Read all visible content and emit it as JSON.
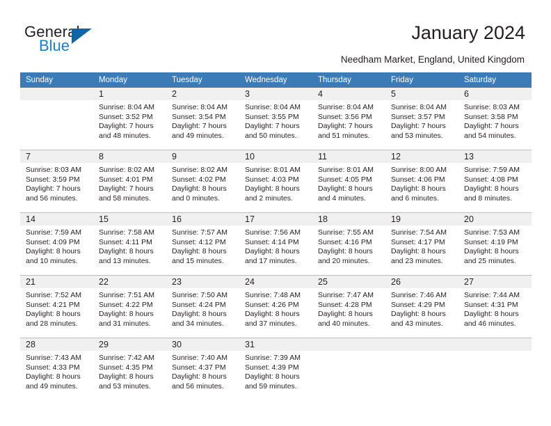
{
  "logo": {
    "word1": "General",
    "word2": "Blue",
    "triangle_color": "#1164a6",
    "blue_color": "#1f7dc0"
  },
  "header": {
    "title": "January 2024",
    "subtitle": "Needham Market, England, United Kingdom",
    "header_bg": "#3b7cb8",
    "daynum_bg": "#f0f0f0"
  },
  "weekdays": [
    "Sunday",
    "Monday",
    "Tuesday",
    "Wednesday",
    "Thursday",
    "Friday",
    "Saturday"
  ],
  "weeks": [
    [
      {
        "day": "",
        "sunrise": "",
        "sunset": "",
        "daylight_line1": "",
        "daylight_line2": ""
      },
      {
        "day": "1",
        "sunrise": "Sunrise: 8:04 AM",
        "sunset": "Sunset: 3:52 PM",
        "daylight_line1": "Daylight: 7 hours",
        "daylight_line2": "and 48 minutes."
      },
      {
        "day": "2",
        "sunrise": "Sunrise: 8:04 AM",
        "sunset": "Sunset: 3:54 PM",
        "daylight_line1": "Daylight: 7 hours",
        "daylight_line2": "and 49 minutes."
      },
      {
        "day": "3",
        "sunrise": "Sunrise: 8:04 AM",
        "sunset": "Sunset: 3:55 PM",
        "daylight_line1": "Daylight: 7 hours",
        "daylight_line2": "and 50 minutes."
      },
      {
        "day": "4",
        "sunrise": "Sunrise: 8:04 AM",
        "sunset": "Sunset: 3:56 PM",
        "daylight_line1": "Daylight: 7 hours",
        "daylight_line2": "and 51 minutes."
      },
      {
        "day": "5",
        "sunrise": "Sunrise: 8:04 AM",
        "sunset": "Sunset: 3:57 PM",
        "daylight_line1": "Daylight: 7 hours",
        "daylight_line2": "and 53 minutes."
      },
      {
        "day": "6",
        "sunrise": "Sunrise: 8:03 AM",
        "sunset": "Sunset: 3:58 PM",
        "daylight_line1": "Daylight: 7 hours",
        "daylight_line2": "and 54 minutes."
      }
    ],
    [
      {
        "day": "7",
        "sunrise": "Sunrise: 8:03 AM",
        "sunset": "Sunset: 3:59 PM",
        "daylight_line1": "Daylight: 7 hours",
        "daylight_line2": "and 56 minutes."
      },
      {
        "day": "8",
        "sunrise": "Sunrise: 8:02 AM",
        "sunset": "Sunset: 4:01 PM",
        "daylight_line1": "Daylight: 7 hours",
        "daylight_line2": "and 58 minutes."
      },
      {
        "day": "9",
        "sunrise": "Sunrise: 8:02 AM",
        "sunset": "Sunset: 4:02 PM",
        "daylight_line1": "Daylight: 8 hours",
        "daylight_line2": "and 0 minutes."
      },
      {
        "day": "10",
        "sunrise": "Sunrise: 8:01 AM",
        "sunset": "Sunset: 4:03 PM",
        "daylight_line1": "Daylight: 8 hours",
        "daylight_line2": "and 2 minutes."
      },
      {
        "day": "11",
        "sunrise": "Sunrise: 8:01 AM",
        "sunset": "Sunset: 4:05 PM",
        "daylight_line1": "Daylight: 8 hours",
        "daylight_line2": "and 4 minutes."
      },
      {
        "day": "12",
        "sunrise": "Sunrise: 8:00 AM",
        "sunset": "Sunset: 4:06 PM",
        "daylight_line1": "Daylight: 8 hours",
        "daylight_line2": "and 6 minutes."
      },
      {
        "day": "13",
        "sunrise": "Sunrise: 7:59 AM",
        "sunset": "Sunset: 4:08 PM",
        "daylight_line1": "Daylight: 8 hours",
        "daylight_line2": "and 8 minutes."
      }
    ],
    [
      {
        "day": "14",
        "sunrise": "Sunrise: 7:59 AM",
        "sunset": "Sunset: 4:09 PM",
        "daylight_line1": "Daylight: 8 hours",
        "daylight_line2": "and 10 minutes."
      },
      {
        "day": "15",
        "sunrise": "Sunrise: 7:58 AM",
        "sunset": "Sunset: 4:11 PM",
        "daylight_line1": "Daylight: 8 hours",
        "daylight_line2": "and 13 minutes."
      },
      {
        "day": "16",
        "sunrise": "Sunrise: 7:57 AM",
        "sunset": "Sunset: 4:12 PM",
        "daylight_line1": "Daylight: 8 hours",
        "daylight_line2": "and 15 minutes."
      },
      {
        "day": "17",
        "sunrise": "Sunrise: 7:56 AM",
        "sunset": "Sunset: 4:14 PM",
        "daylight_line1": "Daylight: 8 hours",
        "daylight_line2": "and 17 minutes."
      },
      {
        "day": "18",
        "sunrise": "Sunrise: 7:55 AM",
        "sunset": "Sunset: 4:16 PM",
        "daylight_line1": "Daylight: 8 hours",
        "daylight_line2": "and 20 minutes."
      },
      {
        "day": "19",
        "sunrise": "Sunrise: 7:54 AM",
        "sunset": "Sunset: 4:17 PM",
        "daylight_line1": "Daylight: 8 hours",
        "daylight_line2": "and 23 minutes."
      },
      {
        "day": "20",
        "sunrise": "Sunrise: 7:53 AM",
        "sunset": "Sunset: 4:19 PM",
        "daylight_line1": "Daylight: 8 hours",
        "daylight_line2": "and 25 minutes."
      }
    ],
    [
      {
        "day": "21",
        "sunrise": "Sunrise: 7:52 AM",
        "sunset": "Sunset: 4:21 PM",
        "daylight_line1": "Daylight: 8 hours",
        "daylight_line2": "and 28 minutes."
      },
      {
        "day": "22",
        "sunrise": "Sunrise: 7:51 AM",
        "sunset": "Sunset: 4:22 PM",
        "daylight_line1": "Daylight: 8 hours",
        "daylight_line2": "and 31 minutes."
      },
      {
        "day": "23",
        "sunrise": "Sunrise: 7:50 AM",
        "sunset": "Sunset: 4:24 PM",
        "daylight_line1": "Daylight: 8 hours",
        "daylight_line2": "and 34 minutes."
      },
      {
        "day": "24",
        "sunrise": "Sunrise: 7:48 AM",
        "sunset": "Sunset: 4:26 PM",
        "daylight_line1": "Daylight: 8 hours",
        "daylight_line2": "and 37 minutes."
      },
      {
        "day": "25",
        "sunrise": "Sunrise: 7:47 AM",
        "sunset": "Sunset: 4:28 PM",
        "daylight_line1": "Daylight: 8 hours",
        "daylight_line2": "and 40 minutes."
      },
      {
        "day": "26",
        "sunrise": "Sunrise: 7:46 AM",
        "sunset": "Sunset: 4:29 PM",
        "daylight_line1": "Daylight: 8 hours",
        "daylight_line2": "and 43 minutes."
      },
      {
        "day": "27",
        "sunrise": "Sunrise: 7:44 AM",
        "sunset": "Sunset: 4:31 PM",
        "daylight_line1": "Daylight: 8 hours",
        "daylight_line2": "and 46 minutes."
      }
    ],
    [
      {
        "day": "28",
        "sunrise": "Sunrise: 7:43 AM",
        "sunset": "Sunset: 4:33 PM",
        "daylight_line1": "Daylight: 8 hours",
        "daylight_line2": "and 49 minutes."
      },
      {
        "day": "29",
        "sunrise": "Sunrise: 7:42 AM",
        "sunset": "Sunset: 4:35 PM",
        "daylight_line1": "Daylight: 8 hours",
        "daylight_line2": "and 53 minutes."
      },
      {
        "day": "30",
        "sunrise": "Sunrise: 7:40 AM",
        "sunset": "Sunset: 4:37 PM",
        "daylight_line1": "Daylight: 8 hours",
        "daylight_line2": "and 56 minutes."
      },
      {
        "day": "31",
        "sunrise": "Sunrise: 7:39 AM",
        "sunset": "Sunset: 4:39 PM",
        "daylight_line1": "Daylight: 8 hours",
        "daylight_line2": "and 59 minutes."
      },
      {
        "day": "",
        "sunrise": "",
        "sunset": "",
        "daylight_line1": "",
        "daylight_line2": ""
      },
      {
        "day": "",
        "sunrise": "",
        "sunset": "",
        "daylight_line1": "",
        "daylight_line2": ""
      },
      {
        "day": "",
        "sunrise": "",
        "sunset": "",
        "daylight_line1": "",
        "daylight_line2": ""
      }
    ]
  ]
}
